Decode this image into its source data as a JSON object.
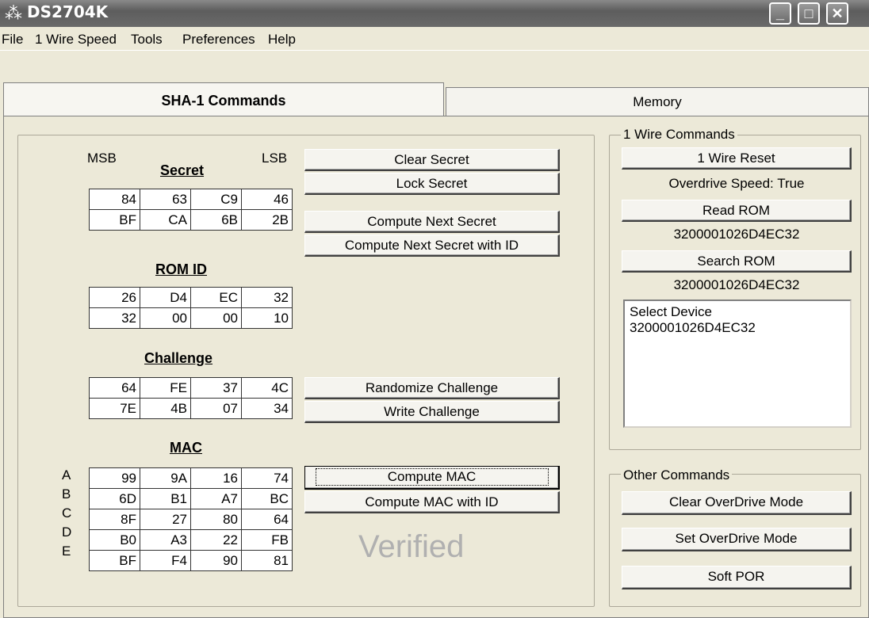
{
  "window": {
    "title": "DS2704K"
  },
  "menu": [
    "File",
    "1 Wire Speed",
    "Tools",
    "Preferences",
    "Help"
  ],
  "tabs": {
    "active": "SHA-1 Commands",
    "inactive": "Memory"
  },
  "secret": {
    "msb_label": "MSB",
    "lsb_label": "LSB",
    "heading": "Secret",
    "rows": [
      [
        "84",
        "63",
        "C9",
        "46"
      ],
      [
        "BF",
        "CA",
        "6B",
        "2B"
      ]
    ]
  },
  "rom_id": {
    "heading": "ROM ID",
    "rows": [
      [
        "26",
        "D4",
        "EC",
        "32"
      ],
      [
        "32",
        "00",
        "00",
        "10"
      ]
    ]
  },
  "challenge": {
    "heading": "Challenge",
    "rows": [
      [
        "64",
        "FE",
        "37",
        "4C"
      ],
      [
        "7E",
        "4B",
        "07",
        "34"
      ]
    ]
  },
  "mac": {
    "heading": "MAC",
    "row_labels": [
      "A",
      "B",
      "C",
      "D",
      "E"
    ],
    "rows": [
      [
        "99",
        "9A",
        "16",
        "74"
      ],
      [
        "6D",
        "B1",
        "A7",
        "BC"
      ],
      [
        "8F",
        "27",
        "80",
        "64"
      ],
      [
        "B0",
        "A3",
        "22",
        "FB"
      ],
      [
        "BF",
        "F4",
        "90",
        "81"
      ]
    ],
    "status": "Verified"
  },
  "buttons": {
    "clear_secret": "Clear Secret",
    "lock_secret": "Lock Secret",
    "compute_next_secret": "Compute Next Secret",
    "compute_next_secret_id": "Compute Next Secret with ID",
    "randomize_challenge": "Randomize Challenge",
    "write_challenge": "Write Challenge",
    "compute_mac": "Compute MAC",
    "compute_mac_id": "Compute MAC with ID"
  },
  "wire_commands": {
    "title": "1 Wire Commands",
    "reset": "1 Wire Reset",
    "overdrive_status": "Overdrive Speed: True",
    "read_rom": "Read ROM",
    "read_rom_value": "3200001026D4EC32",
    "search_rom": "Search ROM",
    "search_rom_value": "3200001026D4EC32",
    "list": [
      "Select Device",
      "3200001026D4EC32"
    ]
  },
  "other_commands": {
    "title": "Other Commands",
    "clear_overdrive": "Clear OverDrive Mode",
    "set_overdrive": "Set OverDrive Mode",
    "soft_por": "Soft POR"
  }
}
